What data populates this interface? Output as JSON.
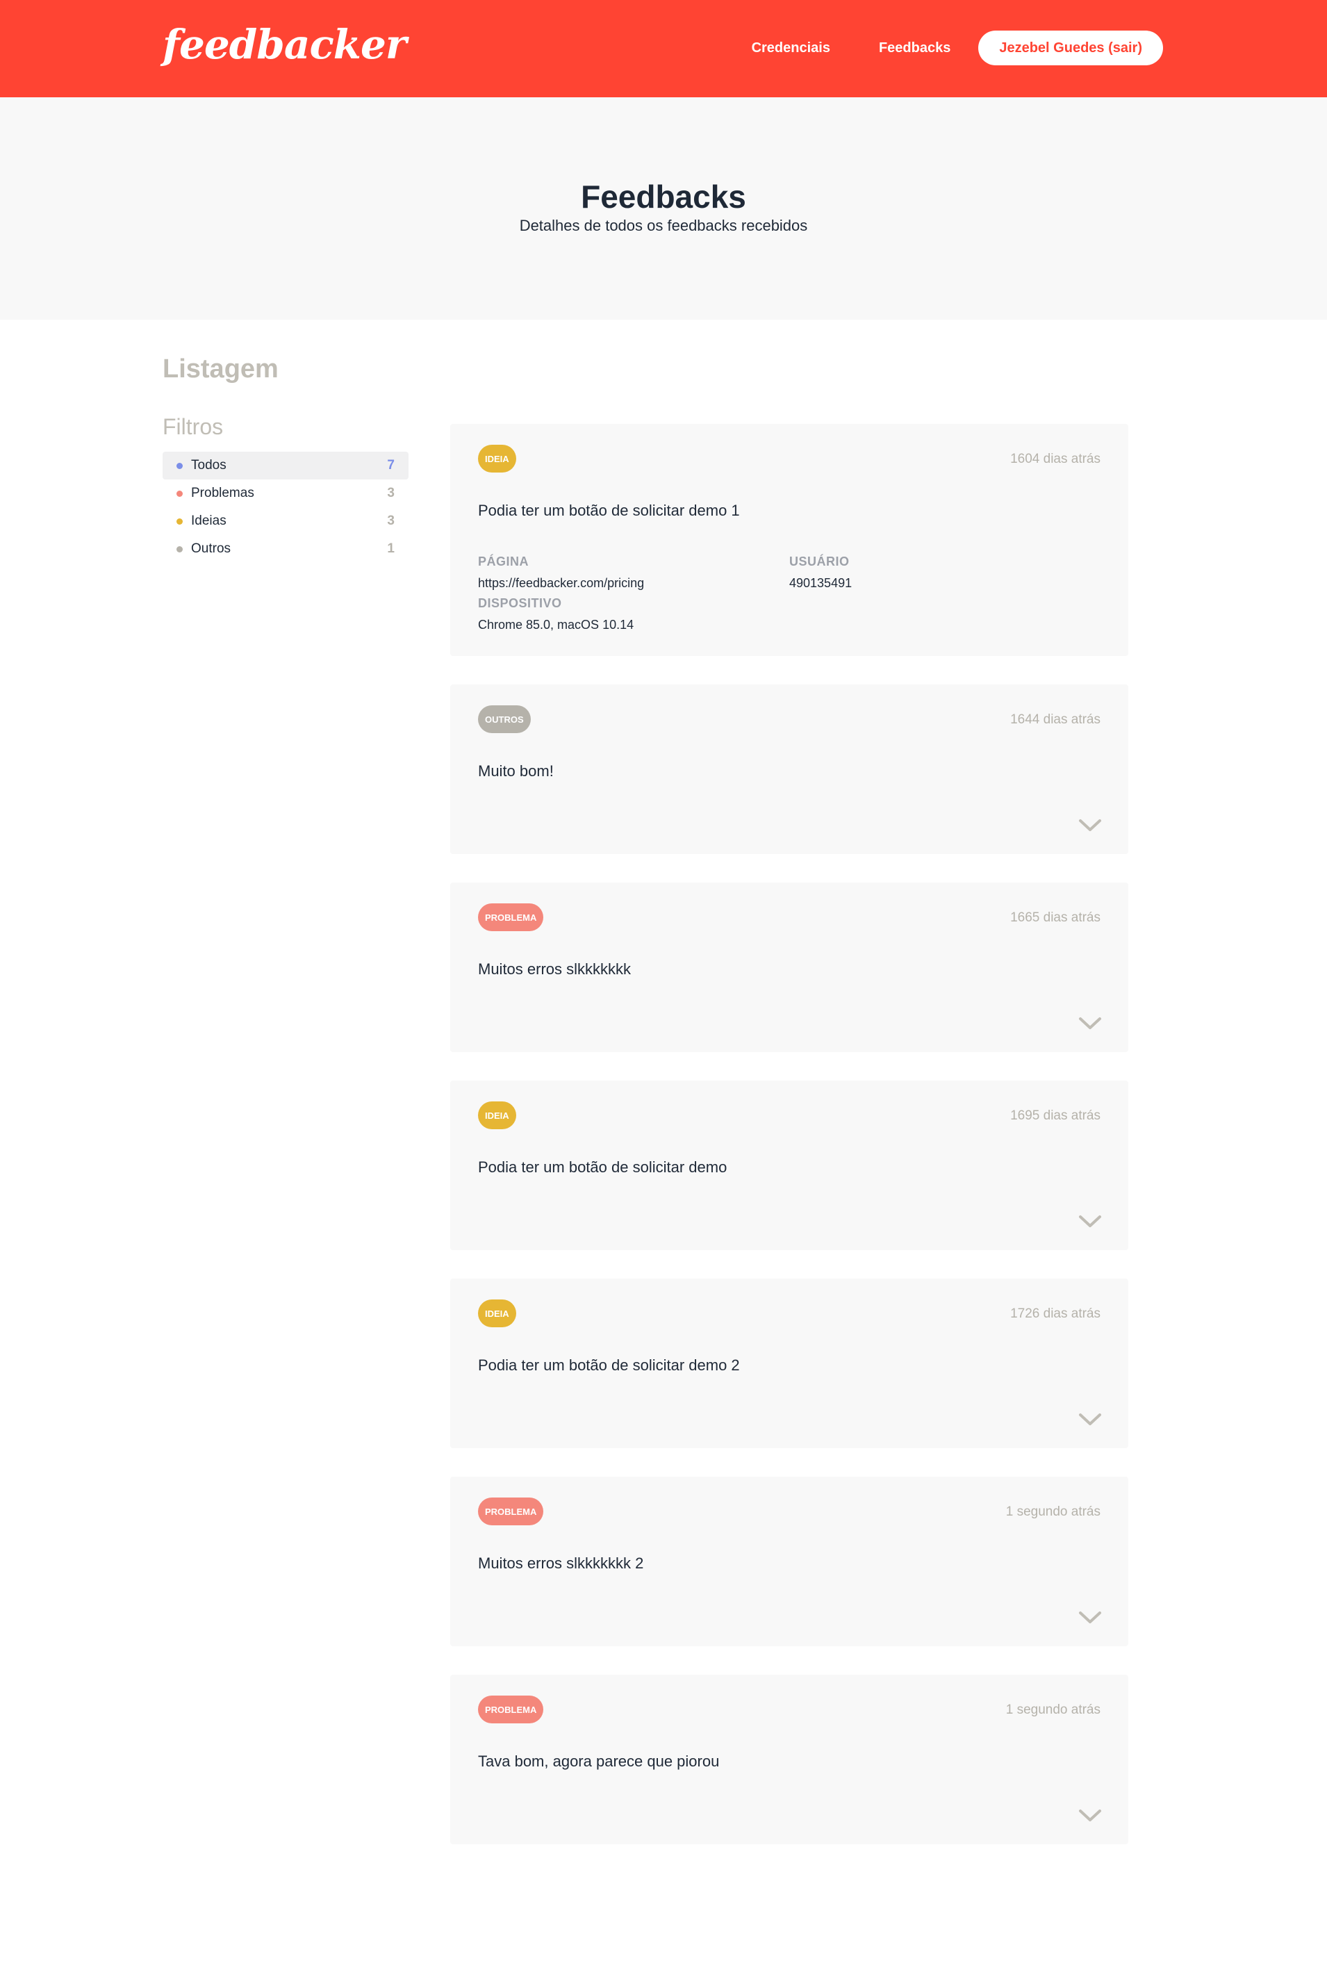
{
  "header": {
    "logo": "feedbacker",
    "nav": {
      "credenciais": "Credenciais",
      "feedbacks": "Feedbacks"
    },
    "logout": "Jezebel Guedes (sair)"
  },
  "hero": {
    "title": "Feedbacks",
    "subtitle": "Detalhes de todos os feedbacks recebidos"
  },
  "sidebar": {
    "listagem": "Listagem",
    "filtros_title": "Filtros",
    "filters": [
      {
        "label": "Todos",
        "count": "7",
        "color": "#7b8ee8"
      },
      {
        "label": "Problemas",
        "count": "3",
        "color": "#f4877b"
      },
      {
        "label": "Ideias",
        "count": "3",
        "color": "#e6b634"
      },
      {
        "label": "Outros",
        "count": "1",
        "color": "#b5b2aa"
      }
    ]
  },
  "colors": {
    "brand": "#ff4433",
    "ideia": "#e6b634",
    "problema": "#f4877b",
    "outros": "#b5b2aa"
  },
  "feedbacks": [
    {
      "badge": "IDEIA",
      "time": "1604 dias atrás",
      "text": "Podia ter um botão de solicitar demo 1",
      "details": {
        "pagina_label": "PÁGINA",
        "pagina": "https://feedbacker.com/pricing",
        "usuario_label": "USUÁRIO",
        "usuario": "490135491",
        "dispositivo_label": "DISPOSITIVO",
        "dispositivo": "Chrome 85.0, macOS 10.14"
      }
    },
    {
      "badge": "OUTROS",
      "time": "1644 dias atrás",
      "text": "Muito bom!"
    },
    {
      "badge": "PROBLEMA",
      "time": "1665 dias atrás",
      "text": "Muitos erros slkkkkkkk"
    },
    {
      "badge": "IDEIA",
      "time": "1695 dias atrás",
      "text": "Podia ter um botão de solicitar demo"
    },
    {
      "badge": "IDEIA",
      "time": "1726 dias atrás",
      "text": "Podia ter um botão de solicitar demo 2"
    },
    {
      "badge": "PROBLEMA",
      "time": "1 segundo atrás",
      "text": "Muitos erros slkkkkkkk 2"
    },
    {
      "badge": "PROBLEMA",
      "time": "1 segundo atrás",
      "text": "Tava bom, agora parece que piorou"
    }
  ]
}
